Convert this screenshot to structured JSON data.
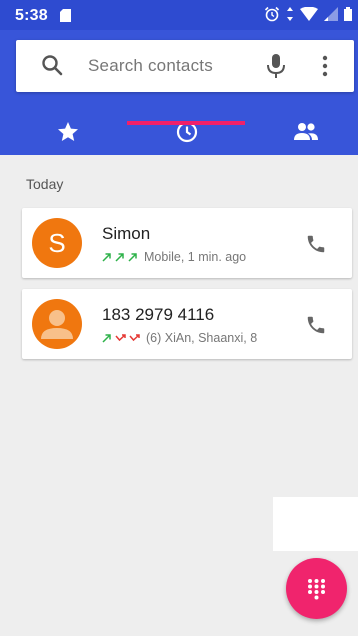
{
  "status_bar": {
    "time": "5:38"
  },
  "search": {
    "placeholder": "Search contacts"
  },
  "tabs": [
    {
      "name": "speed-dial",
      "icon": "star-icon"
    },
    {
      "name": "recents",
      "icon": "clock-icon",
      "selected": true
    },
    {
      "name": "contacts",
      "icon": "people-icon"
    }
  ],
  "section": {
    "label": "Today"
  },
  "calls": [
    {
      "avatar_letter": "S",
      "name": "Simon",
      "detail": "Mobile, 1 min. ago",
      "call_types": [
        "outgoing",
        "outgoing",
        "outgoing"
      ]
    },
    {
      "avatar_letter": "",
      "name": "183 2979 4116",
      "detail": "(6) XiAn, Shaanxi, 8",
      "call_types": [
        "outgoing",
        "missed",
        "missed"
      ]
    }
  ],
  "colors": {
    "header": "#3855d9",
    "status_bar": "#2e4bd0",
    "accent": "#f0206a",
    "avatar": "#f0770f",
    "outgoing": "#2eb24a",
    "missed": "#e53935"
  }
}
